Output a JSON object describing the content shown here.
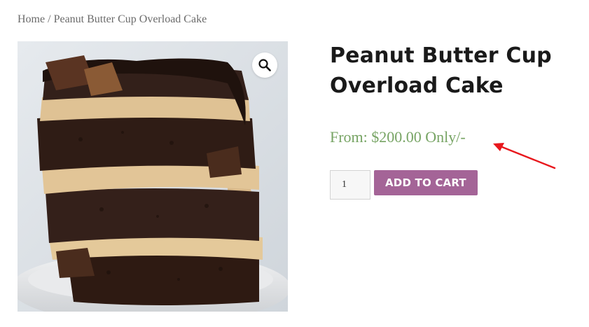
{
  "breadcrumb": {
    "home": "Home",
    "separator": "/",
    "current": "Peanut Butter Cup Overload Cake"
  },
  "product": {
    "title": "Peanut Butter Cup Overload Cake",
    "price": "From: $200.00 Only/-",
    "image_alt": "Peanut Butter Cup Overload Cake",
    "zoom_icon": "magnifier-icon"
  },
  "cart": {
    "quantity": "1",
    "add_to_cart_label": "ADD TO CART"
  },
  "colors": {
    "price": "#77a464",
    "button": "#a46497",
    "annotation": "#e8181d",
    "title": "#1a1a1a"
  }
}
